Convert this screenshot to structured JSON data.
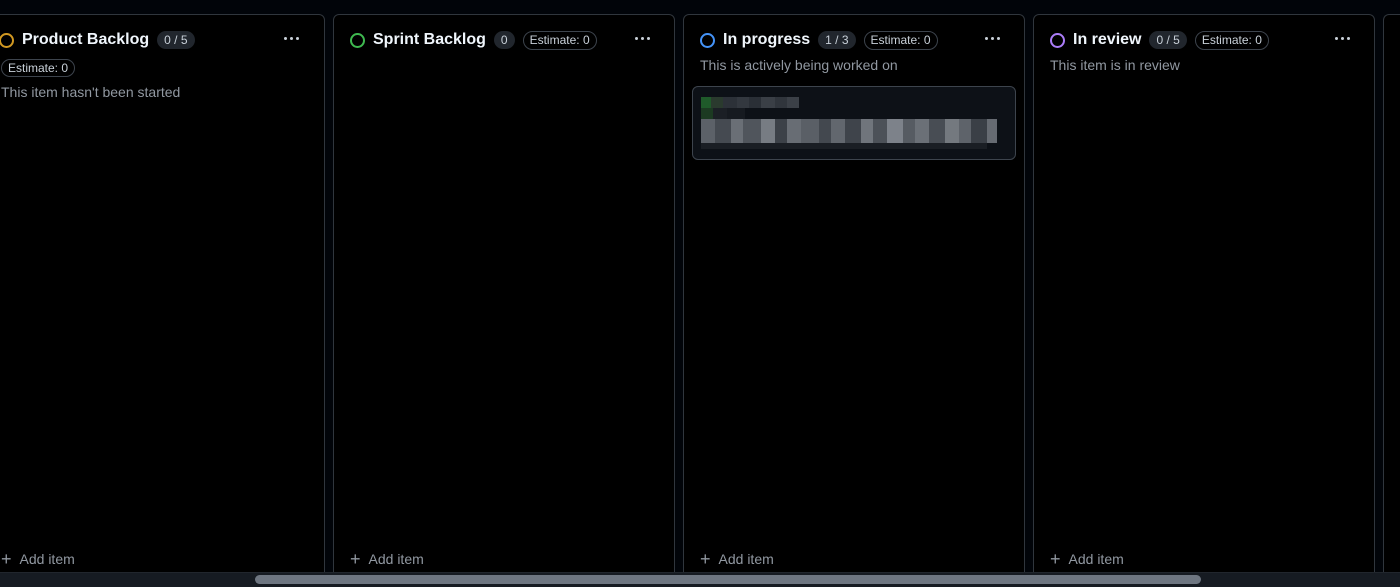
{
  "columns": [
    {
      "title": "Product Backlog",
      "count": "0 / 5",
      "estimate": "Estimate: 0",
      "description": "This item hasn't been started",
      "status_color": "#d29922",
      "add_label": "Add item"
    },
    {
      "title": "Sprint Backlog",
      "count": "0",
      "estimate": "Estimate: 0",
      "description": "",
      "status_color": "#3fb950",
      "add_label": "Add item"
    },
    {
      "title": "In progress",
      "count": "1 / 3",
      "estimate": "Estimate: 0",
      "description": "This is actively being worked on",
      "status_color": "#4493f8",
      "add_label": "Add item"
    },
    {
      "title": "In review",
      "count": "0 / 5",
      "estimate": "Estimate: 0",
      "description": "This item is in review",
      "status_color": "#ab7df8",
      "add_label": "Add item"
    }
  ],
  "icons": {
    "more": "kebab-horizontal-icon",
    "add": "plus-icon",
    "status": "status-circle-icon"
  },
  "colors": {
    "background": "#010409",
    "column_bg": "#000000",
    "border": "#30363d",
    "muted_text": "#9198a1"
  }
}
